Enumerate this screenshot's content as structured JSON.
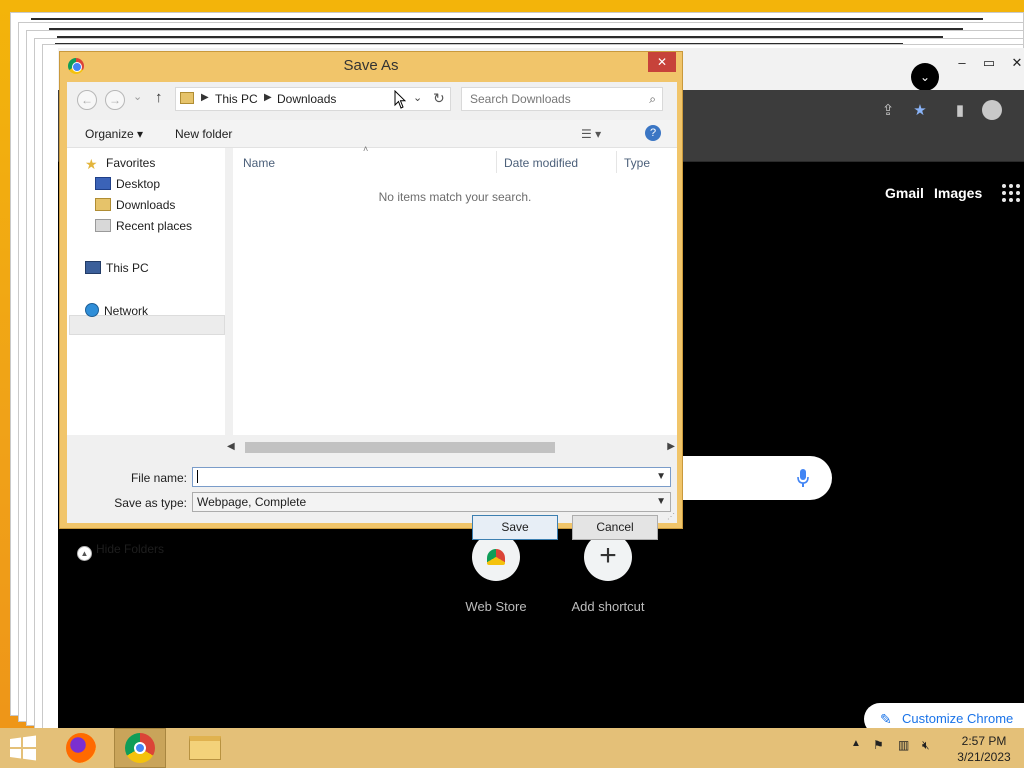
{
  "dialog": {
    "title": "Save As",
    "close_glyph": "✕",
    "nav": {
      "back_glyph": "←",
      "forward_glyph": "→",
      "recent_glyph": "⌄",
      "up_glyph": "↑",
      "breadcrumb": [
        "This PC",
        "Downloads"
      ],
      "refresh_glyph": "↻",
      "search_placeholder": "Search Downloads"
    },
    "toolbar": {
      "organize": "Organize ▾",
      "new_folder": "New folder"
    },
    "sidebar": {
      "favorites": "Favorites",
      "desktop": "Desktop",
      "downloads": "Downloads",
      "recent_places": "Recent places",
      "this_pc": "This PC",
      "network": "Network"
    },
    "columns": [
      "Name",
      "Date modified",
      "Type"
    ],
    "empty_message": "No items match your search.",
    "file_name_label": "File name:",
    "file_name_value": "",
    "save_as_type_label": "Save as type:",
    "save_as_type_value": "Webpage, Complete",
    "hide_folders": "Hide Folders",
    "save_button": "Save",
    "cancel_button": "Cancel"
  },
  "browser": {
    "top_links": [
      "Gmail",
      "Images"
    ],
    "shortcuts": [
      "Web Store",
      "Add shortcut"
    ],
    "add_shortcut_glyph": "+",
    "customize": "Customize Chrome"
  },
  "taskbar": {
    "time": "2:57 PM",
    "date": "3/21/2023"
  },
  "icons": {
    "dialog_app": "chrome-icon",
    "favorites": "star-icon",
    "desktop": "desktop-icon",
    "downloads": "downloads-folder-icon",
    "recent": "recent-places-icon",
    "this_pc": "computer-icon",
    "network": "network-icon",
    "help": "help-icon",
    "view": "view-options-icon"
  },
  "colors": {
    "accent": "#1a73e8",
    "dialog_frame": "#f1c56a",
    "close": "#c7423a",
    "desktop": "#f0a218",
    "taskbar": "#e4c078"
  }
}
